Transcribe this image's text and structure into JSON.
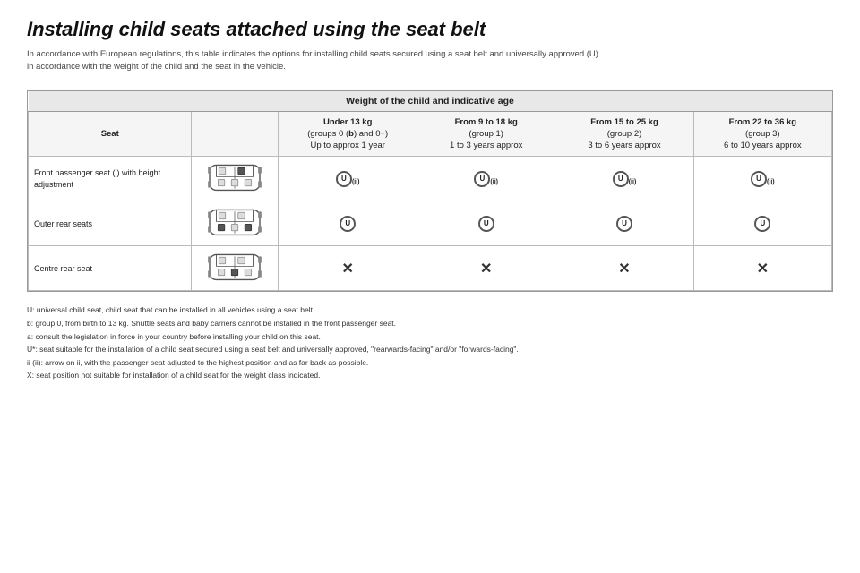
{
  "title": "Installing child seats attached using the seat belt",
  "subtitle_line1": "In accordance with European regulations, this table indicates the options for installing child seats secured using a seat belt and universally approved (U)",
  "subtitle_line2": "in accordance with the weight of the child and the seat in the vehicle.",
  "table": {
    "main_header": "Weight of the child and indicative age",
    "columns": [
      {
        "label": "Seat",
        "sub": ""
      },
      {
        "label": "Under 13 kg",
        "sub": "(groups 0 (b) and 0+)\nUp to approx 1 year"
      },
      {
        "label": "From 9 to 18 kg",
        "sub": "(group 1)\n1 to 3 years approx"
      },
      {
        "label": "From 15 to 25 kg",
        "sub": "(group 2)\n3 to 6 years approx"
      },
      {
        "label": "From 22 to 36 kg",
        "sub": "(group 3)\n6 to 10 years approx"
      }
    ],
    "rows": [
      {
        "seat_name": "Front passenger seat (i) with height adjustment",
        "car_type": "front_highlighted",
        "values": [
          "U (ii)",
          "U (ii)",
          "U (ii)",
          "U (ii)"
        ]
      },
      {
        "seat_name": "Outer rear seats",
        "car_type": "rear_outer",
        "values": [
          "U",
          "U",
          "U",
          "U"
        ]
      },
      {
        "seat_name": "Centre rear seat",
        "car_type": "rear_centre",
        "values": [
          "X",
          "X",
          "X",
          "X"
        ]
      }
    ]
  },
  "footnotes": [
    "U: universal child seat, child seat that can be installed in all vehicles using a seat belt.",
    "b: group 0, from birth to 13 kg. Shuttle seats and baby carriers cannot be installed in the front passenger seat.",
    "a: consult the legislation in force in your country before installing your child on this seat.",
    "U*: seat suitable for the installation of a child seat secured using a seat belt and universally approved, \"rearwards-facing\" and/or \"forwards-facing\".",
    "ii (ii): arrow on ii, with the passenger seat adjusted to the highest position and as far back as possible.",
    "X: seat position not suitable for installation of a child seat for the weight class indicated."
  ]
}
